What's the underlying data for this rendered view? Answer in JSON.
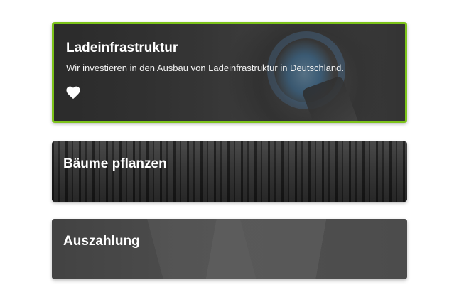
{
  "cards": [
    {
      "title": "Ladeinfrastruktur",
      "description": "Wir investieren in den Ausbau von Ladeinfrastruktur in Deutschland.",
      "selected": true,
      "icon": "heart-icon",
      "border_color": "#7cc31a"
    },
    {
      "title": "Bäume pflanzen",
      "selected": false
    },
    {
      "title": "Auszahlung",
      "selected": false
    }
  ]
}
